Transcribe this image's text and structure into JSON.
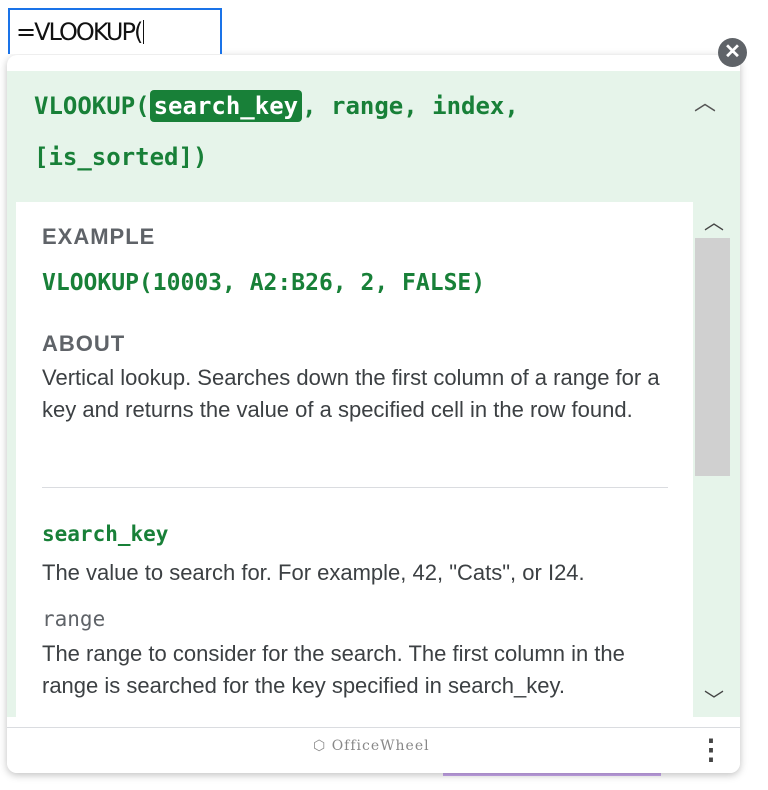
{
  "cell": {
    "formula": "=VLOOKUP("
  },
  "signature": {
    "name": "VLOOKUP(",
    "active_arg": "search_key",
    "rest_line1": ", range, index,",
    "line2": "[is_sorted])"
  },
  "example": {
    "label": "EXAMPLE",
    "code": "VLOOKUP(10003, A2:B26, 2, FALSE)"
  },
  "about": {
    "label": "ABOUT",
    "text": "Vertical lookup. Searches down the first column of a range for a key and returns the value of a specified cell in the row found."
  },
  "params": [
    {
      "name": "search_key",
      "text": "The value to search for. For example, 42, \"Cats\", or I24."
    },
    {
      "name": "range",
      "text": "The range to consider for the search. The first column in the range is searched for the key specified in search_key."
    }
  ],
  "footer": {
    "logo_text": "OfficeWheel"
  },
  "icons": {
    "close": "close-icon",
    "collapse": "chevron-up-icon",
    "more": "more-vert-icon"
  },
  "colors": {
    "accent": "#188038",
    "header_bg": "#e6f4ea",
    "cell_border": "#1a73e8"
  }
}
